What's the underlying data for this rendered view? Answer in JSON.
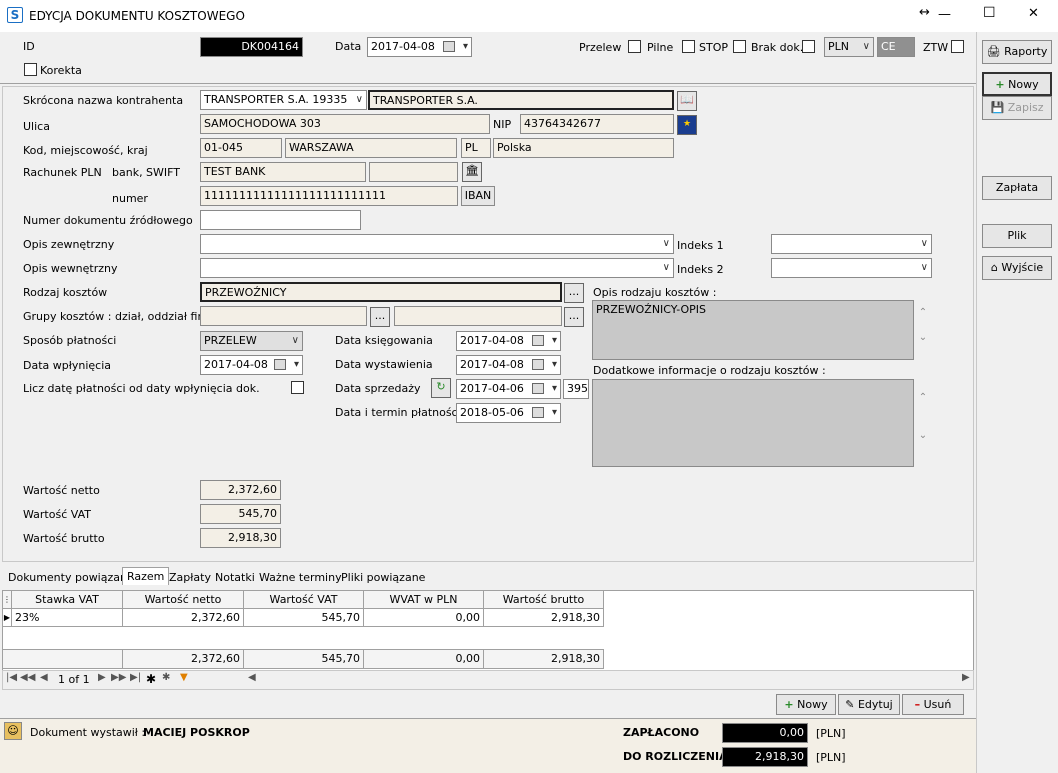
{
  "window": {
    "title": "EDYCJA DOKUMENTU KOSZTOWEGO",
    "minimize": "—",
    "maximize": "☐",
    "close": "✕"
  },
  "header": {
    "id_label": "ID",
    "id_value": "DK004164",
    "data_label": "Data",
    "data_value": "2017-04-08",
    "przelew_label": "Przelew",
    "pilne_label": "Pilne",
    "stop_label": "STOP",
    "brak_dok_label": "Brak dok.",
    "currency_value": "PLN",
    "ce_value": "CE",
    "ztw_label": "ZTW",
    "korekta_label": "Korekta"
  },
  "form": {
    "kontrahent_label": "Skrócona nazwa kontrahenta",
    "kontrahent_code": "TRANSPORTER S.A. 19335",
    "kontrahent_name": "TRANSPORTER S.A.",
    "ulica_label": "Ulica",
    "ulica_value": "SAMOCHODOWA 303",
    "nip_label": "NIP",
    "nip_value": "43764342677",
    "kod_label": "Kod, miejscowość, kraj",
    "kod_value": "01-045",
    "miasto_value": "WARSZAWA",
    "kraj_code": "PL",
    "kraj_name": "Polska",
    "rachunek_label": "Rachunek PLN",
    "bank_label": "bank, SWIFT",
    "bank_value": "TEST BANK",
    "swift_value": "",
    "numer_label": "numer",
    "numer_value": "11111111111111111111111111",
    "iban_label": "IBAN",
    "zrodlowy_label": "Numer dokumentu źródłowego",
    "zrodlowy_value": "",
    "opis_zew_label": "Opis zewnętrzny",
    "opis_zew_value": "",
    "indeks1_label": "Indeks 1",
    "indeks1_value": "",
    "opis_wew_label": "Opis wewnętrzny",
    "opis_wew_value": "",
    "indeks2_label": "Indeks 2",
    "indeks2_value": "",
    "rodzaj_label": "Rodzaj kosztów",
    "rodzaj_value": "PRZEWOŹNICY",
    "opis_rodzaju_label": "Opis rodzaju kosztów :",
    "opis_rodzaju_value": "PRZEWOŹNICY-OPIS",
    "grupy_label": "Grupy kosztów : dział, oddział firmy",
    "sposob_label": "Sposób płatności",
    "sposob_value": "PRZELEW",
    "wplyniecia_label": "Data wpłynięcia",
    "wplyniecia_value": "2017-04-08",
    "licz_label": "Licz datę płatności od daty wpłynięcia dok.",
    "ksiegowania_label": "Data księgowania",
    "ksiegowania_value": "2017-04-08",
    "wystawienia_label": "Data wystawienia",
    "wystawienia_value": "2017-04-08",
    "sprzedazy_label": "Data sprzedaży",
    "sprzedazy_value": "2017-04-06",
    "sprzedazy_days": "395",
    "termin_label": "Data i termin płatności",
    "termin_value": "2018-05-06",
    "dodatkowe_label": "Dodatkowe informacje o rodzaju kosztów :",
    "netto_label": "Wartość netto",
    "netto_value": "2,372,60",
    "vat_label": "Wartość VAT",
    "vat_value": "545,70",
    "brutto_label": "Wartość brutto",
    "brutto_value": "2,918,30"
  },
  "tabs": [
    "Dokumenty powiązane",
    "Razem",
    "Zapłaty",
    "Notatki",
    "Ważne terminy",
    "Pliki powiązane"
  ],
  "grid": {
    "columns": [
      "Stawka VAT",
      "Wartość netto",
      "Wartość VAT",
      "WVAT w PLN",
      "Wartość brutto"
    ],
    "row": [
      "23%",
      "2,372,60",
      "545,70",
      "0,00",
      "2,918,30"
    ],
    "totals": [
      "2,372,60",
      "545,70",
      "0,00",
      "2,918,30"
    ],
    "pager": "1 of 1"
  },
  "grid_buttons": {
    "nowy": "Nowy",
    "edytuj": "Edytuj",
    "usun": "Usuń"
  },
  "footer": {
    "wystawil_label": "Dokument wystawił :",
    "wystawil_value": "MACIEJ POSKROP",
    "zaplacono_label": "ZAPŁACONO",
    "zaplacono_value": "0,00",
    "zaplacono_cur": "[PLN]",
    "rozliczenia_label": "DO ROZLICZENIA",
    "rozliczenia_value": "2,918,30",
    "rozliczenia_cur": "[PLN]"
  },
  "sidebar": {
    "raporty": "Raporty",
    "nowy": "Nowy",
    "zapisz": "Zapisz",
    "zaplata": "Zapłata",
    "plik": "Plik",
    "wyjscie": "Wyjście"
  },
  "colors": {
    "accent": "#1a6fc4",
    "dark_field": "#000000",
    "gray_field": "#c8c8c8"
  }
}
